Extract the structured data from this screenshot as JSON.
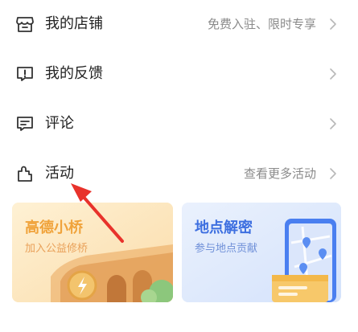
{
  "menu": {
    "items": [
      {
        "label": "我的店铺",
        "hint": "免费入驻、限时专享",
        "icon": "store-icon"
      },
      {
        "label": "我的反馈",
        "hint": "",
        "icon": "feedback-icon"
      },
      {
        "label": "评论",
        "hint": "",
        "icon": "comment-icon"
      },
      {
        "label": "活动",
        "hint": "查看更多活动",
        "icon": "activity-puzzle-icon"
      }
    ]
  },
  "cards": {
    "bridge": {
      "title": "高德小桥",
      "subtitle": "加入公益修桥",
      "accent": "#f0a33b"
    },
    "places": {
      "title": "地点解密",
      "subtitle": "参与地点贡献",
      "accent": "#3d6fe0"
    }
  },
  "colors": {
    "arrow": "#e8322b",
    "text": "#222222",
    "hint": "#8a8a8a"
  }
}
